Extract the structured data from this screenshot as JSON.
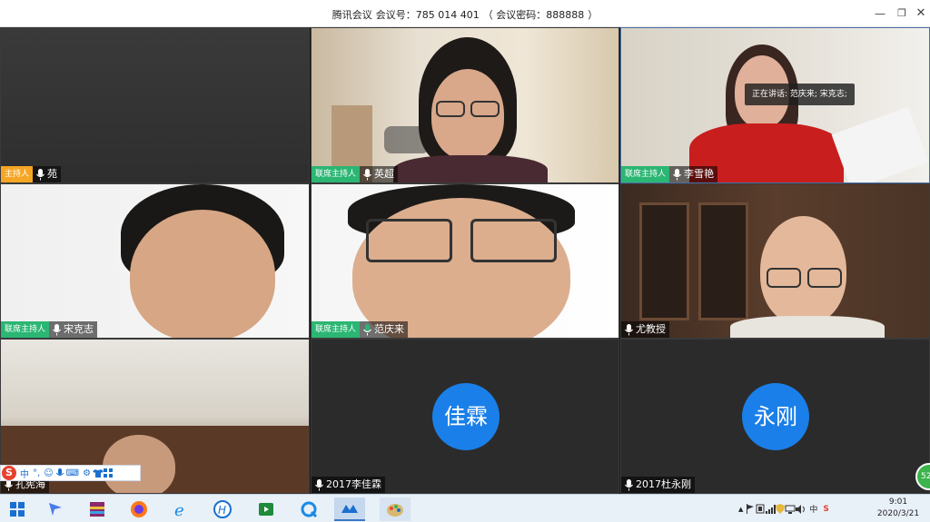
{
  "window": {
    "app_name": "腾讯会议",
    "meeting_id_label": "会议号：",
    "meeting_id": "785 014 401",
    "password_label": "（ 会议密码：",
    "password": "888888",
    "password_close": "）",
    "min_icon": "minimize-icon",
    "max_icon": "restore-icon",
    "close_icon": "close-icon"
  },
  "speaking": {
    "label": "正在讲话: 范庆来; 宋克志;"
  },
  "tiles": [
    {
      "role": "主持人",
      "role_type": "host",
      "name": "苑"
    },
    {
      "role": "联席主持人",
      "role_type": "cohost",
      "name": "英超"
    },
    {
      "role": "联席主持人",
      "role_type": "cohost",
      "name": "李雪艳"
    },
    {
      "role": "联席主持人",
      "role_type": "cohost",
      "name": "宋克志"
    },
    {
      "role": "联席主持人",
      "role_type": "cohost",
      "name": "范庆来"
    },
    {
      "role": "",
      "role_type": "none",
      "name": "尤教授"
    },
    {
      "role": "",
      "role_type": "none",
      "name": "孔宪海"
    },
    {
      "role": "",
      "role_type": "none",
      "name": "2017李佳霖",
      "avatar": "佳霖"
    },
    {
      "role": "",
      "role_type": "none",
      "name": "2017杜永刚",
      "avatar": "永刚"
    }
  ],
  "ime": {
    "logo": "S",
    "mode": "中",
    "items": [
      "°,",
      "☺",
      "mic",
      "⌨",
      "⚙",
      "shirt",
      "grid"
    ]
  },
  "badge": "52",
  "taskbar": {
    "icons": [
      "windows-start-icon",
      "feishu-icon",
      "winrar-icon",
      "firefox-icon",
      "ie-icon",
      "h-app-icon",
      "video-app-icon",
      "q-app-icon",
      "tencent-meeting-icon",
      "paint-icon"
    ],
    "tray": {
      "up_arrow": "▲",
      "ime": "中",
      "sogou": "S"
    },
    "time": "9:01",
    "date": "2020/3/21"
  },
  "colors": {
    "host": "#f5a623",
    "cohost": "#2bb673",
    "avatar": "#1a7fe8",
    "taskbar": "#e8f0f8"
  }
}
